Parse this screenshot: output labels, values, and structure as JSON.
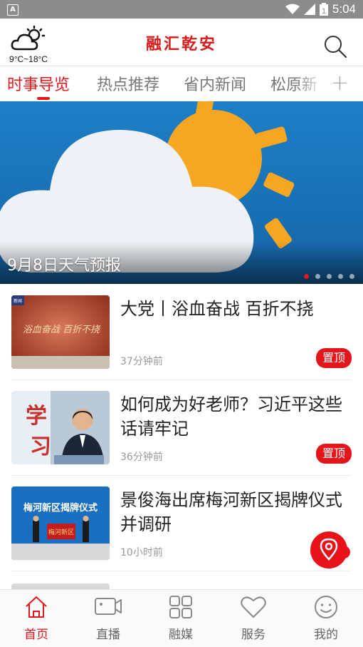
{
  "statusbar": {
    "time": "5:04",
    "notif_glyph": "A",
    "battery_digit": "1"
  },
  "header": {
    "temperature": "9°C~18°C",
    "title": "融汇乾安"
  },
  "tabs": [
    {
      "label": "时事导览",
      "active": true
    },
    {
      "label": "热点推荐",
      "active": false
    },
    {
      "label": "省内新闻",
      "active": false
    },
    {
      "label": "松原新",
      "active": false
    }
  ],
  "add_tab_symbol": "+",
  "banner": {
    "caption": "9月8日天气预报",
    "slides": 5,
    "active_slide": 1
  },
  "news": [
    {
      "title": "大党丨浴血奋战 百折不挠",
      "time": "37分钟前",
      "badge": "置顶",
      "thumb_texts": [
        "浴血奋战 百折不挠",
        "新闻"
      ]
    },
    {
      "title": "如何成为好老师？习近平这些话请牢记",
      "time": "36分钟前",
      "badge": "置顶",
      "thumb_texts": [
        "学",
        "习"
      ]
    },
    {
      "title": "景俊海出席梅河新区揭牌仪式并调研",
      "time": "10小时前",
      "badge": "",
      "thumb_texts": [
        "梅河新区揭牌仪式",
        "梅河新区"
      ]
    }
  ],
  "bottom_nav": [
    {
      "label": "首页",
      "icon": "home-icon",
      "active": true
    },
    {
      "label": "直播",
      "icon": "camera-icon",
      "active": false
    },
    {
      "label": "融媒",
      "icon": "grid-icon",
      "active": false
    },
    {
      "label": "服务",
      "icon": "heart-icon",
      "active": false
    },
    {
      "label": "我的",
      "icon": "smile-icon",
      "active": false
    }
  ],
  "colors": {
    "accent": "#e3161c",
    "title": "#d81a1a",
    "banner_sky": "#1a75b8",
    "sun": "#f5a623"
  }
}
